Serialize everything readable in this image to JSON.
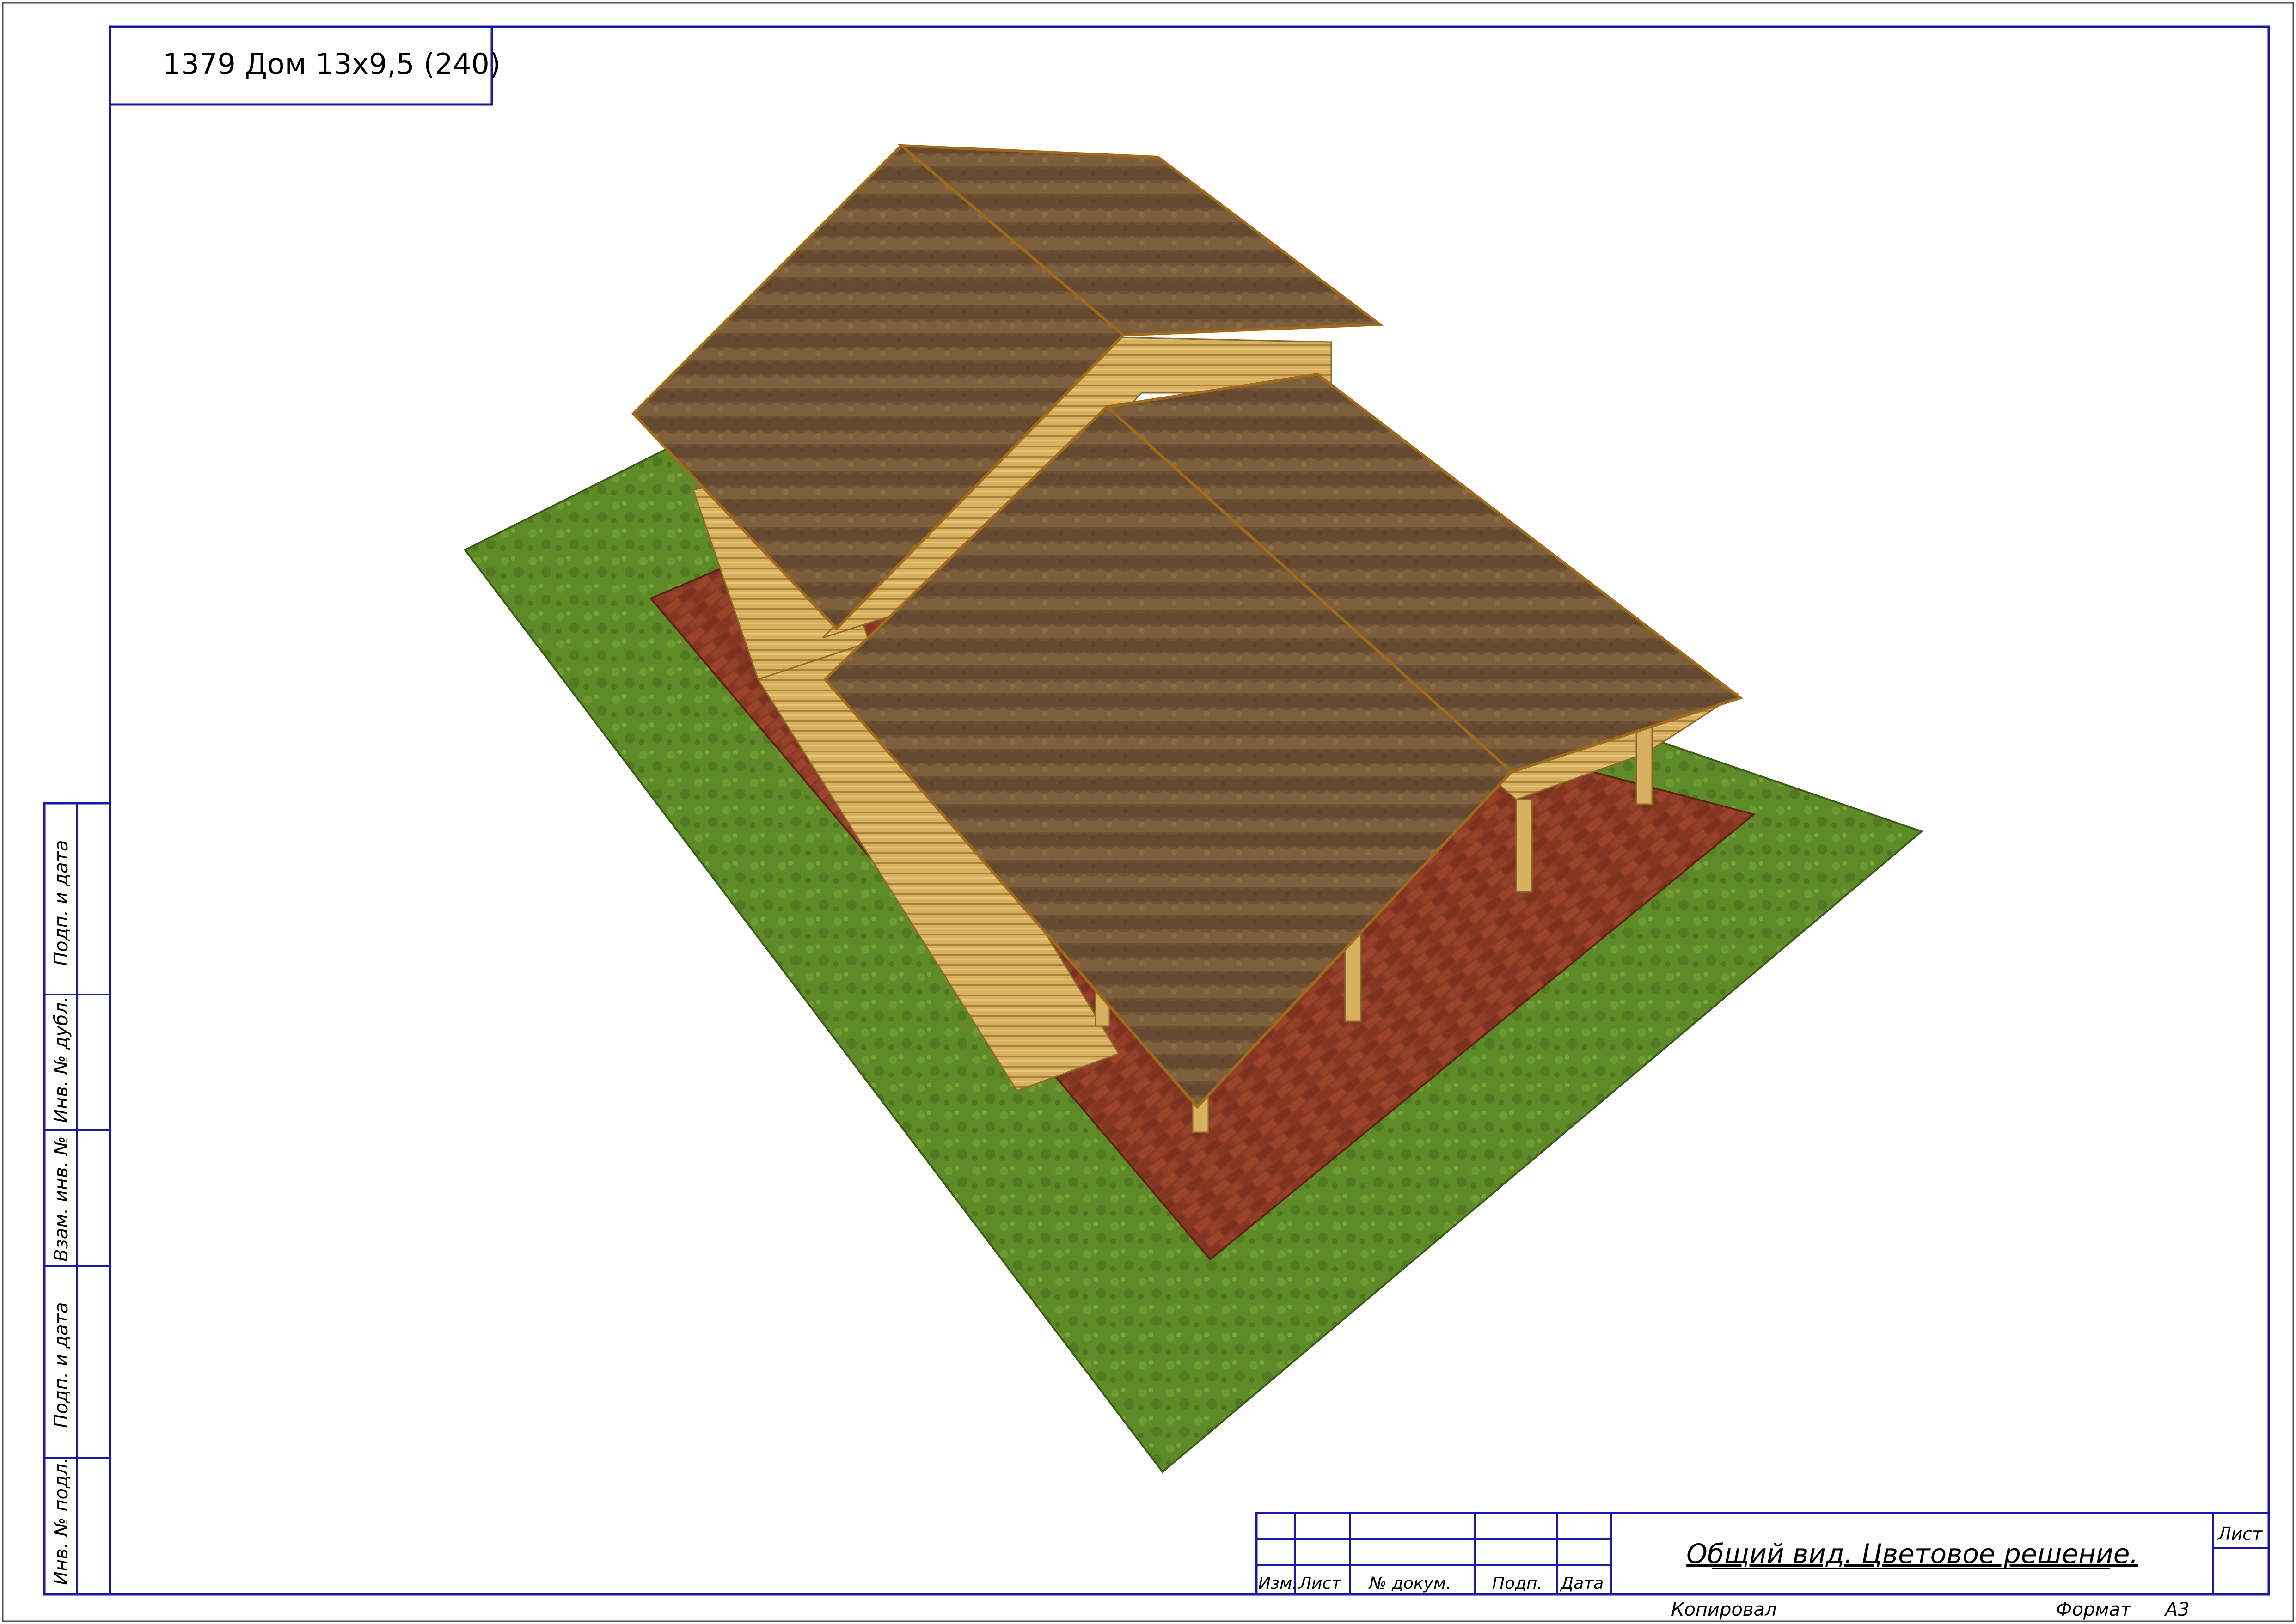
{
  "drawing": {
    "title": "1379 Дом 13х9,5 (240)"
  },
  "title_block": {
    "caption": "Общий вид. Цветовое решение.",
    "sheet_label": "Лист",
    "columns": {
      "izm": "Изм.",
      "list": "Лист",
      "doc_no": "№ докум.",
      "sign": "Подп.",
      "date": "Дата"
    },
    "copied": "Копировал",
    "format_label": "Формат",
    "format_value": "А3"
  },
  "side_stamp": {
    "sign_date_top": "Подп. и дата",
    "dupl_no": "Инв. № дубл.",
    "swap_no": "Взам. инв. №",
    "sign_date_bottom": "Подп. и дата",
    "orig_no": "Инв. № подл."
  },
  "colors": {
    "lawn": "#5e8a28",
    "paving": "#8a3a24",
    "roof": "#6e5236",
    "timber": "#d7b15f",
    "frame": "#1a1aa0"
  }
}
